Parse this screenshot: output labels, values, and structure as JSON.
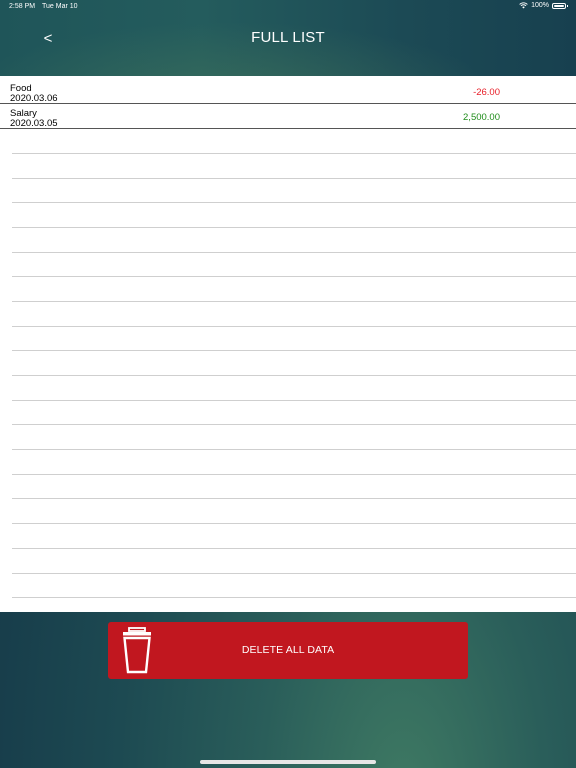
{
  "status_bar": {
    "time": "2:58 PM",
    "date": "Tue Mar 10",
    "battery": "100%"
  },
  "header": {
    "back_label": "<",
    "title": "FULL LIST"
  },
  "entries": [
    {
      "name": "Food",
      "date": "2020.03.06",
      "amount": "-26.00",
      "amount_color": "#e8202a"
    },
    {
      "name": "Salary",
      "date": "2020.03.05",
      "amount": "2,500.00",
      "amount_color": "#1f8c1a"
    }
  ],
  "footer": {
    "delete_label": "DELETE ALL DATA",
    "delete_icon": "trash-icon",
    "button_color": "#c1171f"
  }
}
